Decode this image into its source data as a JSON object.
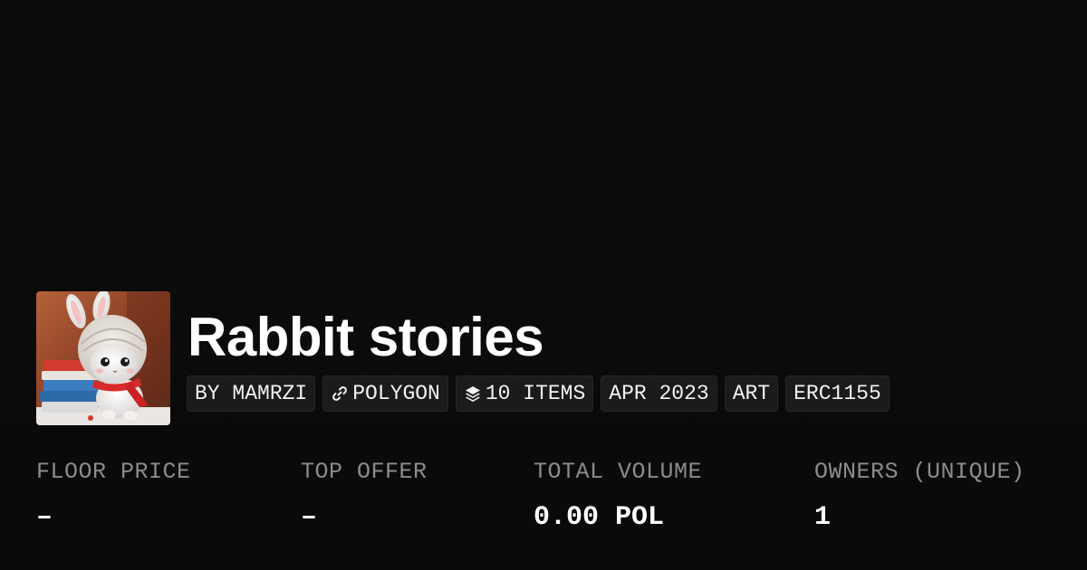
{
  "collection": {
    "title": "Rabbit stories",
    "avatar_icon": "rabbit-avatar-image"
  },
  "tags": [
    {
      "label": "BY MAMRZI",
      "icon": ""
    },
    {
      "label": "POLYGON",
      "icon": "chain-link-icon"
    },
    {
      "label": "10 ITEMS",
      "icon": "layers-icon"
    },
    {
      "label": "APR 2023",
      "icon": ""
    },
    {
      "label": "ART",
      "icon": ""
    },
    {
      "label": "ERC1155",
      "icon": ""
    }
  ],
  "stats": [
    {
      "label": "FLOOR PRICE",
      "value": "–"
    },
    {
      "label": "TOP OFFER",
      "value": "–"
    },
    {
      "label": "TOTAL VOLUME",
      "value": "0.00 POL"
    },
    {
      "label": "OWNERS (UNIQUE)",
      "value": "1"
    }
  ],
  "colors": {
    "background": "#0b0b0b",
    "tag_background": "#1b1b1b",
    "label_gray": "#8c8c8c",
    "text_white": "#ffffff"
  }
}
